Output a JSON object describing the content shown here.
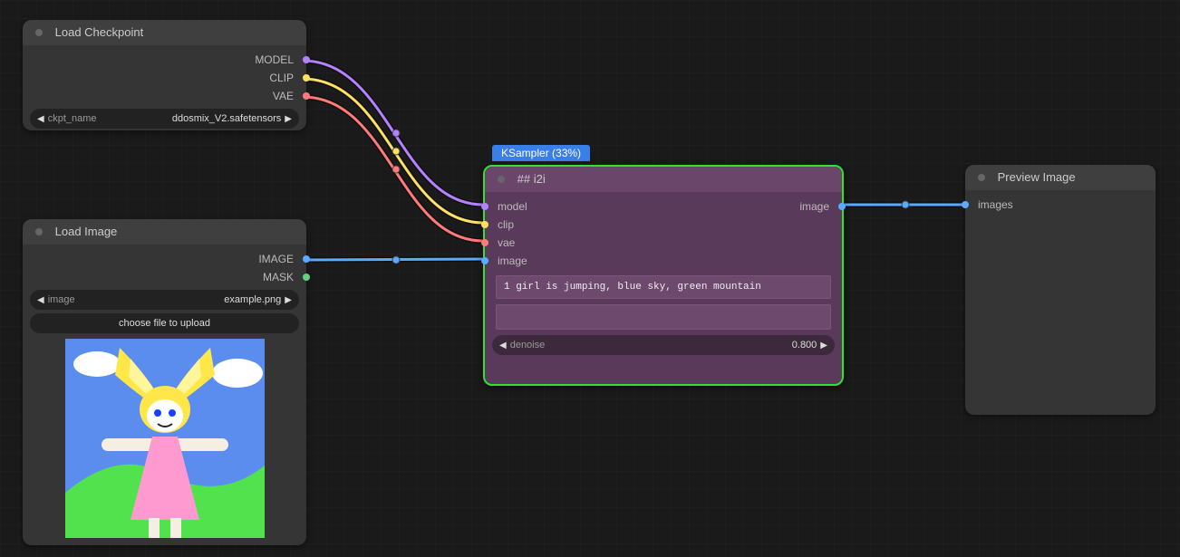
{
  "nodes": {
    "load_ckpt": {
      "title": "Load Checkpoint",
      "outputs": {
        "model": "MODEL",
        "clip": "CLIP",
        "vae": "VAE"
      },
      "widget": {
        "name": "ckpt_name",
        "value": "ddosmix_V2.safetensors"
      }
    },
    "load_image": {
      "title": "Load Image",
      "outputs": {
        "image": "IMAGE",
        "mask": "MASK"
      },
      "widget": {
        "name": "image",
        "value": "example.png"
      },
      "button": "choose file to upload"
    },
    "i2i": {
      "badge": "KSampler (33%)",
      "title": "## i2i",
      "inputs": {
        "model": "model",
        "clip": "clip",
        "vae": "vae",
        "image": "image"
      },
      "outputs": {
        "image": "image"
      },
      "prompt": "1 girl is jumping, blue sky, green mountain",
      "neg_prompt": "",
      "widget": {
        "name": "denoise",
        "value": "0.800"
      }
    },
    "preview": {
      "title": "Preview Image",
      "inputs": {
        "images": "images"
      }
    }
  },
  "colors": {
    "model": "#b482ff",
    "clip": "#ffe060",
    "vae": "#ff7a7a",
    "image": "#5aaaff",
    "green_border": "#31e231",
    "badge": "#3a7fe8"
  }
}
